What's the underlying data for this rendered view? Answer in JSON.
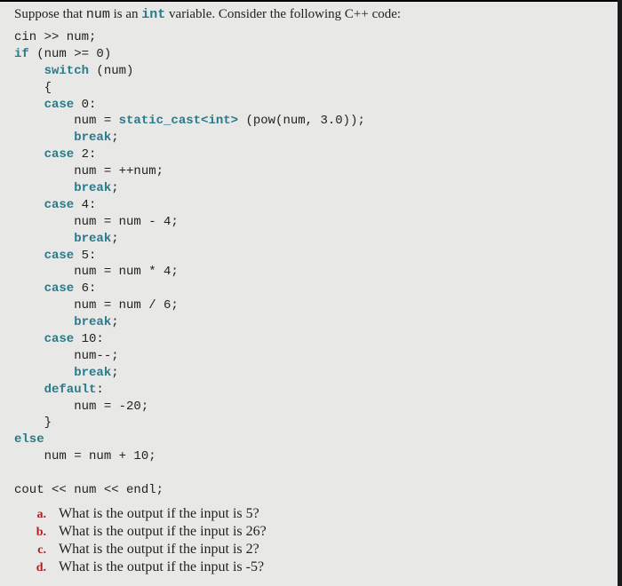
{
  "prompt": {
    "prefix": "Suppose that ",
    "var": "num",
    "mid": " is an ",
    "type": "int",
    "suffix": " variable. Consider the following C++ code:"
  },
  "code": {
    "l1": "cin >> num;",
    "l2a": "if",
    "l2b": " (num >= 0)",
    "l3a": "    switch",
    "l3b": " (num)",
    "l4": "    {",
    "l5a": "    case",
    "l5b": " 0:",
    "l6a": "        num = ",
    "l6b": "static_cast<int>",
    "l6c": " (pow(num, 3.0));",
    "l7a": "        break",
    "l7b": ";",
    "l8a": "    case",
    "l8b": " 2:",
    "l9": "        num = ++num;",
    "l10a": "        break",
    "l10b": ";",
    "l11a": "    case",
    "l11b": " 4:",
    "l12": "        num = num - 4;",
    "l13a": "        break",
    "l13b": ";",
    "l14a": "    case",
    "l14b": " 5:",
    "l15": "        num = num * 4;",
    "l16a": "    case",
    "l16b": " 6:",
    "l17": "        num = num / 6;",
    "l18a": "        break",
    "l18b": ";",
    "l19a": "    case",
    "l19b": " 10:",
    "l20": "        num--;",
    "l21a": "        break",
    "l21b": ";",
    "l22a": "    default",
    "l22b": ":",
    "l23": "        num = -20;",
    "l24": "    }",
    "l25": "else",
    "l26": "    num = num + 10;",
    "l27": "cout << num << endl;"
  },
  "questions": [
    {
      "label": "a.",
      "text": "What is the output if the input is 5?"
    },
    {
      "label": "b.",
      "text": "What is the output if the input is 26?"
    },
    {
      "label": "c.",
      "text": "What is the output if the input is 2?"
    },
    {
      "label": "d.",
      "text": "What is the output if the input is -5?"
    }
  ]
}
